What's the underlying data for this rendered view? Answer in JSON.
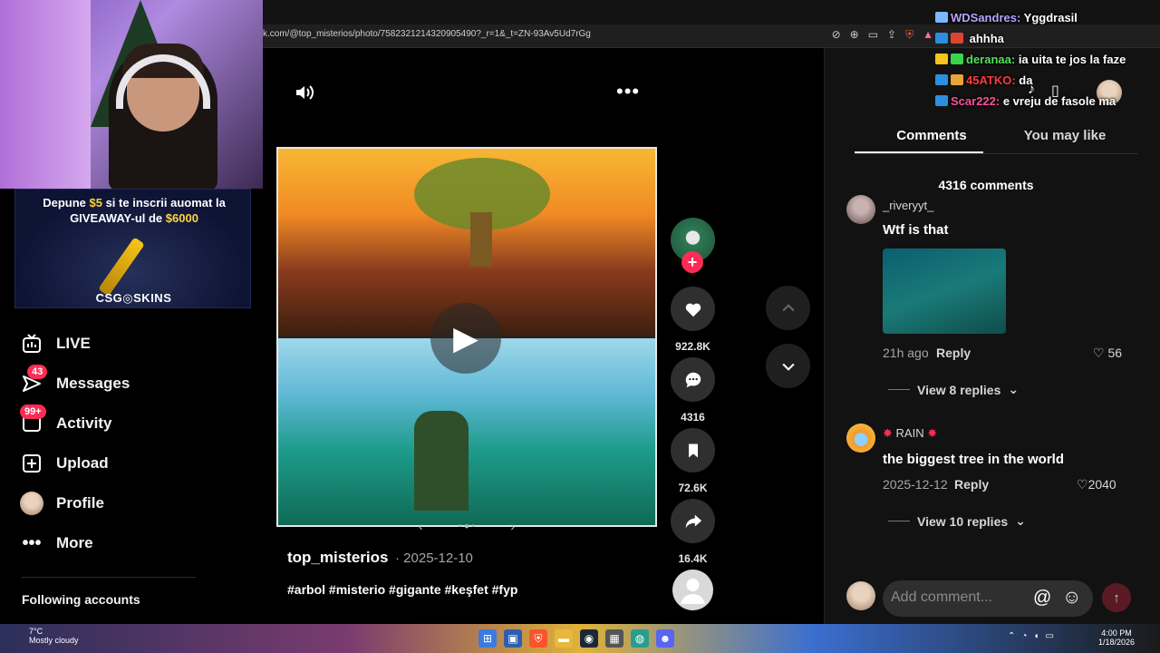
{
  "browser": {
    "url": "k.com/@top_misterios/photo/7582321214320905490?_r=1&_t=ZN-93Av5Ud7rGg"
  },
  "sidebar": {
    "items": [
      {
        "label": "LIVE",
        "icon": "live-icon"
      },
      {
        "label": "Messages",
        "icon": "messages-icon",
        "badge": "43"
      },
      {
        "label": "Activity",
        "icon": "activity-icon",
        "badge": "99+"
      },
      {
        "label": "Upload",
        "icon": "upload-icon"
      },
      {
        "label": "Profile",
        "icon": "avatar"
      },
      {
        "label": "More",
        "icon": "more-icon"
      }
    ],
    "following_label": "Following accounts"
  },
  "banner": {
    "line1_a": "Depune ",
    "line1_amount": "$5",
    "line1_b": " si te inscrii auomat la",
    "line2_a": "GIVEAWAY-ul de ",
    "line2_amount": "$6000",
    "logo": "CSG◎SKINS"
  },
  "post": {
    "author": "top_misterios",
    "date": "· 2025-12-10",
    "hashtags": "#arbol #misterio #gigante #keşfet #fyp"
  },
  "actions": {
    "likes": "922.8K",
    "comments": "4316",
    "saves": "72.6K",
    "shares": "16.4K"
  },
  "panel": {
    "tab_comments": "Comments",
    "tab_you_may_like": "You may like",
    "comment_count": "4316 comments",
    "comments": [
      {
        "user": "_riveryyt_",
        "text": "Wtf is that",
        "time": "21h ago",
        "reply": "Reply",
        "likes": "56",
        "view_replies": "View 8 replies"
      },
      {
        "user": "RAIN",
        "text": "the biggest tree in the world",
        "time": "2025-12-12",
        "reply": "Reply",
        "likes": "2040",
        "view_replies": "View 10 replies"
      }
    ],
    "add_comment_placeholder": "Add comment..."
  },
  "chat": [
    {
      "user": "WDSandres:",
      "msg": " Yggdrasil",
      "cls": "u1"
    },
    {
      "user": "",
      "msg": " ahhha",
      "cls": "u2"
    },
    {
      "user": "deranaa:",
      "msg": " ia uita te jos la faze",
      "cls": "u3"
    },
    {
      "user": "45ATKO:",
      "msg": " da",
      "cls": "u4"
    },
    {
      "user": "Scar222:",
      "msg": " e vreju de fasole ma",
      "cls": "u5"
    }
  ],
  "taskbar": {
    "weather_temp": "7°C",
    "weather_desc": "Mostly cloudy",
    "time": "4:00 PM",
    "date": "1/18/2026"
  },
  "colors": {
    "accent": "#fe2c55",
    "panel_bg": "#121212",
    "gold": "#ffd43b"
  }
}
